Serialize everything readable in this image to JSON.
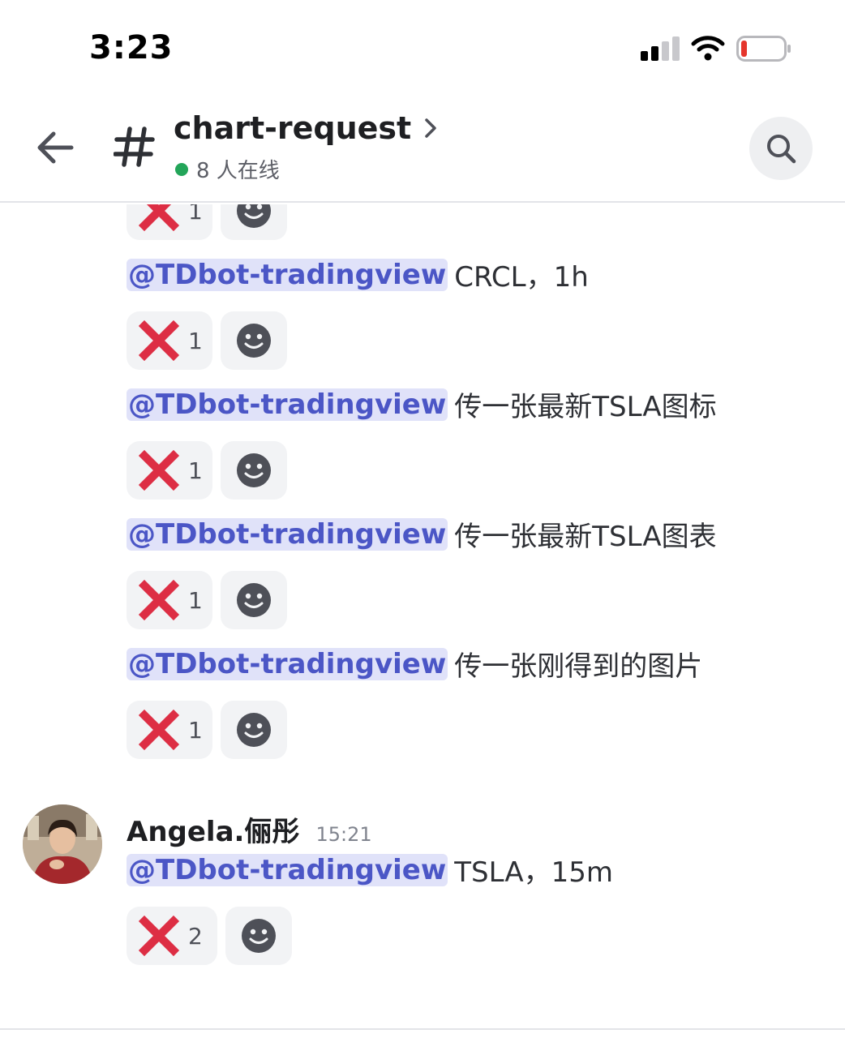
{
  "status_bar": {
    "time": "3:23"
  },
  "header": {
    "channel_name": "chart-request",
    "online_text": "8 人在线"
  },
  "messages": [
    {
      "mention": "@TDbot-tradingview",
      "text": "CRCL，1h",
      "reaction_count": "1"
    },
    {
      "mention": "@TDbot-tradingview",
      "text": "传一张最新TSLA图标",
      "reaction_count": "1"
    },
    {
      "mention": "@TDbot-tradingview",
      "text": "传一张最新TSLA图表",
      "reaction_count": "1"
    },
    {
      "mention": "@TDbot-tradingview",
      "text": "传一张刚得到的图片",
      "reaction_count": "1"
    }
  ],
  "top_partial_reaction_count": "1",
  "last_message": {
    "author": "Angela.俪彤",
    "timestamp": "15:21",
    "mention": "@TDbot-tradingview",
    "text": "TSLA，15m",
    "reaction_count": "2"
  },
  "colors": {
    "mention_bg": "#e0e2f9",
    "mention_text": "#4b56c6",
    "online": "#23a559",
    "reaction_x": "#dd2e44",
    "battery_low": "#e5352c"
  },
  "icons": {
    "back": "arrow-left-icon",
    "channel": "hash-icon",
    "search": "search-icon",
    "reaction": "cross-mark-emoji",
    "add_reaction": "smiley-icon"
  }
}
